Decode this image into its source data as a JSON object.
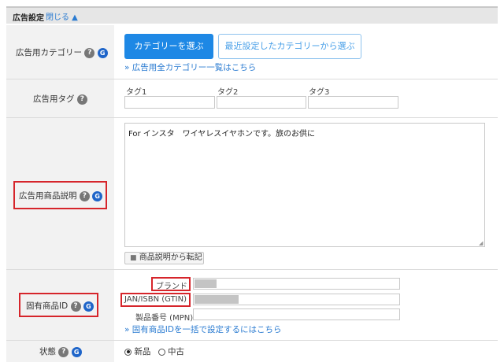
{
  "header": {
    "title": "広告設定",
    "close_label": "閉じる ▲"
  },
  "category": {
    "label": "広告用カテゴリー",
    "select_button": "カテゴリーを選ぶ",
    "recent_button": "最近設定したカテゴリーから選ぶ",
    "all_link": "» 広告用全カテゴリー一覧はこちら"
  },
  "tags": {
    "label": "広告用タグ",
    "tag1_label": "タグ1",
    "tag2_label": "タグ2",
    "tag3_label": "タグ3",
    "tag1_value": "",
    "tag2_value": "",
    "tag3_value": ""
  },
  "description": {
    "label": "広告用商品説明",
    "text": "For インスタ　ワイヤレスイヤホンです。旅のお供に",
    "copy_button": "商品説明から転記"
  },
  "product_id": {
    "label": "固有商品ID",
    "brand_label": "ブランド",
    "jan_label": "JAN/ISBN (GTIN)",
    "mpn_label": "製品番号 (MPN)",
    "mpn_value": "",
    "bulk_link": "» 固有商品IDを一括で設定するにはこちら"
  },
  "condition": {
    "label": "状態",
    "options": [
      {
        "label": "新品",
        "checked": true
      },
      {
        "label": "中古",
        "checked": false
      }
    ]
  },
  "icons": {
    "help": "?",
    "google": "G"
  },
  "colors": {
    "accent": "#1e88e5",
    "link": "#2a7bd1",
    "highlight": "#d6252b",
    "label_bg": "#f2f2f2"
  }
}
